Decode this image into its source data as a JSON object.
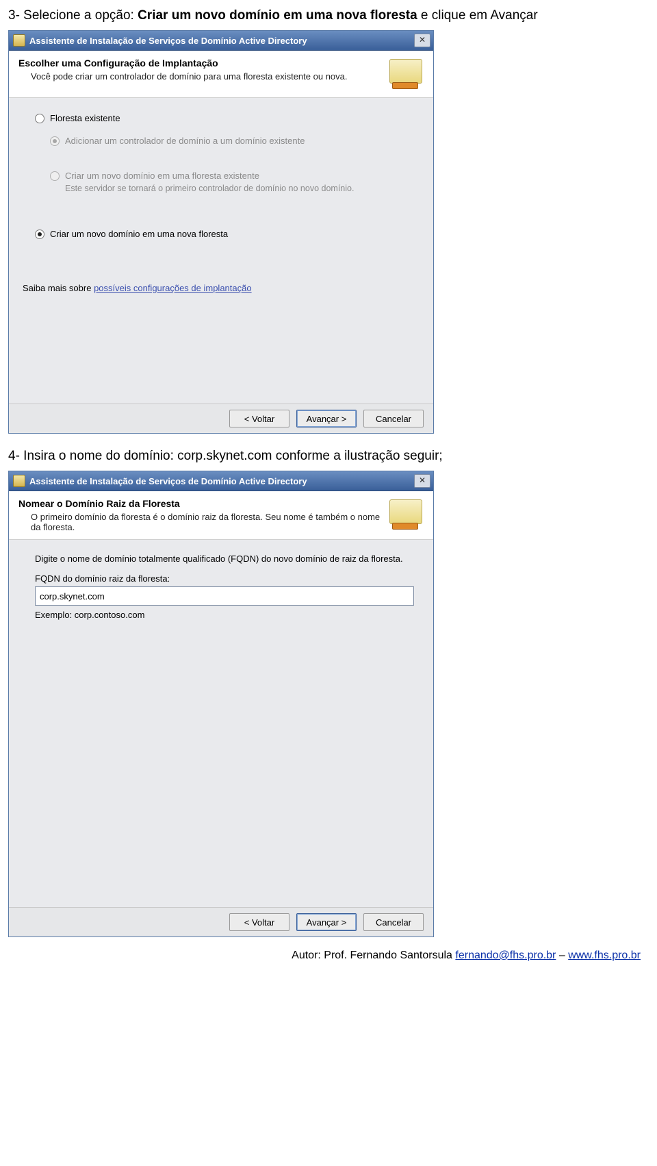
{
  "doc": {
    "step3_prefix": "3- Selecione a opção: ",
    "step3_bold": "Criar um novo domínio em uma nova floresta",
    "step3_suffix": " e clique em Avançar",
    "step4_prefix": "4- Insira o nome do domínio: ",
    "step4_bold": "corp.skynet.com",
    "step4_suffix": " conforme a ilustração seguir;"
  },
  "dialog1": {
    "title": "Assistente de Instalação de Serviços de Domínio Active Directory",
    "close_icon": "✕",
    "header_title": "Escolher uma Configuração de Implantação",
    "header_desc": "Você pode criar um controlador de domínio para uma floresta existente ou nova.",
    "options": {
      "existing": "Floresta existente",
      "add_controller": "Adicionar um controlador de domínio a um domínio existente",
      "new_in_existing": "Criar um novo domínio em uma floresta existente",
      "new_in_existing_note": "Este servidor se tornará o primeiro controlador de domínio no novo domínio.",
      "new_forest": "Criar um novo domínio em uma nova floresta"
    },
    "learn_more_prefix": "Saiba mais sobre ",
    "learn_more_link": "possíveis configurações de implantação",
    "buttons": {
      "back": "< Voltar",
      "next": "Avançar >",
      "cancel": "Cancelar"
    }
  },
  "dialog2": {
    "title": "Assistente de Instalação de Serviços de Domínio Active Directory",
    "close_icon": "✕",
    "header_title": "Nomear o Domínio Raiz da Floresta",
    "header_desc": "O primeiro domínio da floresta é o domínio raiz da floresta. Seu nome é também o nome da floresta.",
    "instruction": "Digite o nome de domínio totalmente qualificado (FQDN) do novo domínio de raiz da floresta.",
    "field_label": "FQDN do domínio raiz da floresta:",
    "field_value": "corp.skynet.com",
    "example": "Exemplo: corp.contoso.com",
    "buttons": {
      "back": "< Voltar",
      "next": "Avançar >",
      "cancel": "Cancelar"
    }
  },
  "footer": {
    "prefix": "Autor: Prof. Fernando Santorsula ",
    "email": "fernando@fhs.pro.br",
    "dash": " – ",
    "site": "www.fhs.pro.br"
  }
}
